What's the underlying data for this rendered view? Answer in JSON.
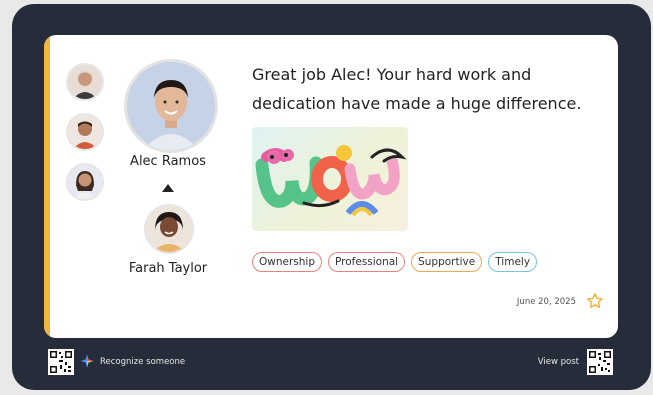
{
  "recipient": {
    "name": "Alec Ramos"
  },
  "giver": {
    "name": "Farah Taylor"
  },
  "message": "Great job Alec! Your hard work and dedication have made a huge difference.",
  "gif": {
    "icon": "wow-sticker-icon"
  },
  "tags": [
    {
      "label": "Ownership",
      "color": "#e8847a"
    },
    {
      "label": "Professional",
      "color": "#e8847a"
    },
    {
      "label": "Supportive",
      "color": "#f0a855"
    },
    {
      "label": "Timely",
      "color": "#7ac4de"
    }
  ],
  "date": "June 20, 2025",
  "footer": {
    "recognize_label": "Recognize someone",
    "view_label": "View post"
  },
  "colors": {
    "accent_bar": "#f2b63d",
    "frame": "#262c3a",
    "star": "#f2b63d"
  }
}
